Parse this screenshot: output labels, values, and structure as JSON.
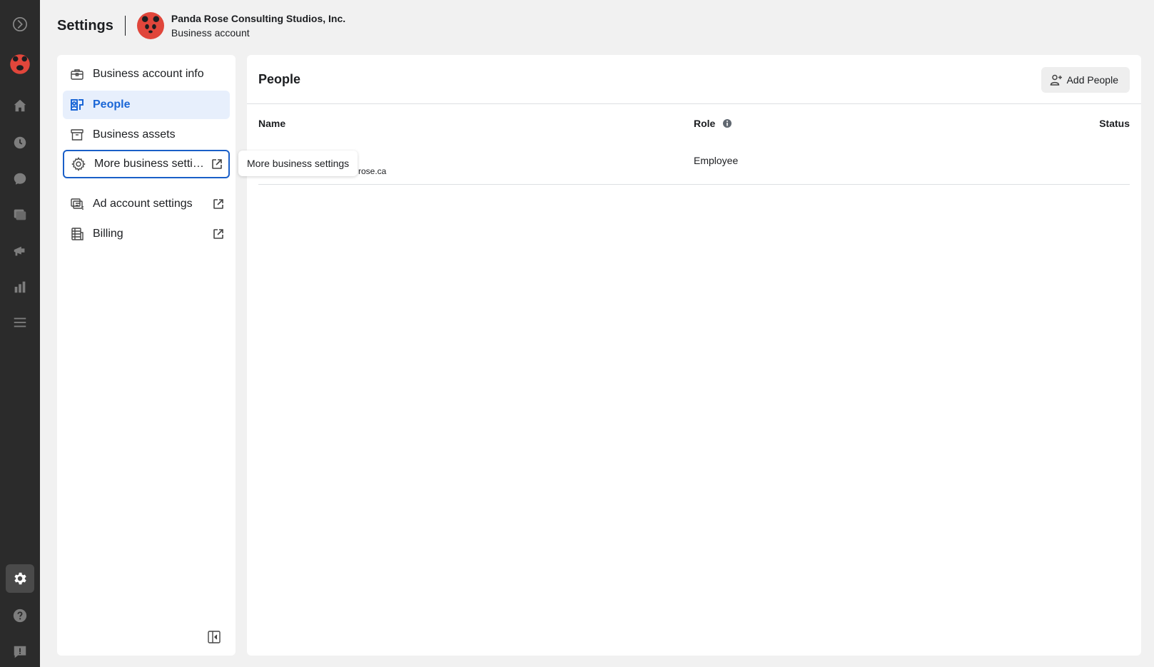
{
  "header": {
    "title": "Settings",
    "business_name": "Panda Rose Consulting Studios, Inc.",
    "business_type": "Business account"
  },
  "rail": {
    "items": [
      {
        "name": "meta-logo-icon"
      },
      {
        "name": "business-avatar-icon"
      },
      {
        "name": "home-icon"
      },
      {
        "name": "activity-icon"
      },
      {
        "name": "inbox-icon"
      },
      {
        "name": "content-icon"
      },
      {
        "name": "ads-icon"
      },
      {
        "name": "insights-icon"
      },
      {
        "name": "menu-icon"
      },
      {
        "name": "settings-icon",
        "active": true
      },
      {
        "name": "help-icon"
      },
      {
        "name": "feedback-icon"
      }
    ]
  },
  "sidebar": {
    "items": [
      {
        "label": "Business account info",
        "icon": "briefcase-icon",
        "external": false
      },
      {
        "label": "People",
        "icon": "people-icon",
        "external": false,
        "active": true
      },
      {
        "label": "Business assets",
        "icon": "archive-icon",
        "external": false
      },
      {
        "label": "More business setti…",
        "icon": "gear-icon",
        "external": true,
        "focused": true
      },
      {
        "label": "Ad account settings",
        "icon": "ad-account-icon",
        "external": true
      },
      {
        "label": "Billing",
        "icon": "billing-icon",
        "external": true
      }
    ]
  },
  "tooltip": {
    "text": "More business settings"
  },
  "main": {
    "title": "People",
    "add_button": "Add People",
    "columns": {
      "name": "Name",
      "role": "Role",
      "status": "Status"
    },
    "rows": [
      {
        "email": "rose.ca",
        "role": "Employee",
        "status": ""
      }
    ]
  },
  "colors": {
    "rail_bg": "#2b2b2b",
    "accent": "#1a66d6",
    "active_bg": "#e7effc",
    "brand_red": "#e0463b"
  }
}
